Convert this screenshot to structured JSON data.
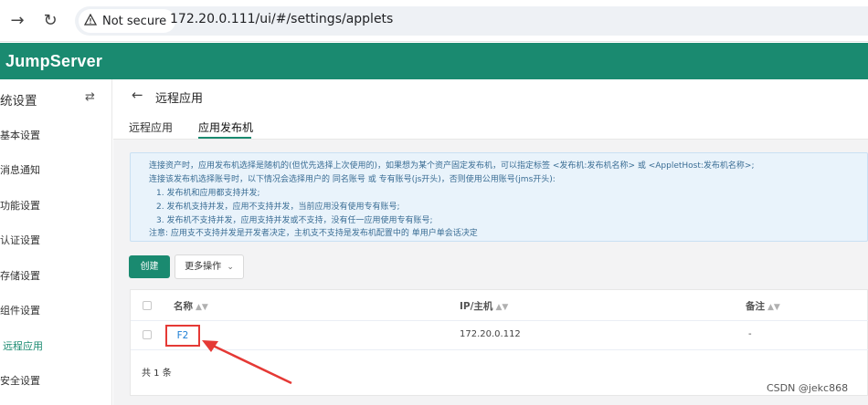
{
  "browser": {
    "back_icon": "arrow-right-icon",
    "reload_icon": "reload-icon",
    "secure_label": "Not secure",
    "url": "172.20.0.111/ui/#/settings/applets"
  },
  "header": {
    "brand": "JumpServer",
    "accent_color": "#1a8a70"
  },
  "sidebar": {
    "title": "统设置",
    "items": [
      {
        "label": "基本设置"
      },
      {
        "label": "消息通知"
      },
      {
        "label": "功能设置"
      },
      {
        "label": "认证设置"
      },
      {
        "label": "存储设置"
      },
      {
        "label": "组件设置"
      },
      {
        "label": "远程应用"
      },
      {
        "label": "安全设置"
      }
    ]
  },
  "page": {
    "title": "远程应用",
    "tabs": [
      {
        "label": "远程应用"
      },
      {
        "label": "应用发布机"
      }
    ],
    "alert": [
      "连接资产时，应用发布机选择是随机的(但优先选择上次使用的)，如果想为某个资产固定发布机，可以指定标签 <发布机:发布机名称> 或 <AppletHost:发布机名称>;",
      "连接该发布机选择账号时，以下情况会选择用户的 同名账号 或 专有账号(js开头)，否则使用公用账号(jms开头):",
      "1. 发布机和应用都支持并发;",
      "2. 发布机支持并发，应用不支持并发，当前应用没有使用专有账号;",
      "3. 发布机不支持并发，应用支持并发或不支持，没有任一应用使用专有账号;",
      "注意: 应用支不支持并发是开发者决定，主机支不支持是发布机配置中的 单用户单会话决定"
    ],
    "create_label": "创建",
    "more_label": "更多操作"
  },
  "table": {
    "columns": [
      "名称",
      "IP/主机",
      "备注"
    ],
    "rows": [
      {
        "name": "F2",
        "ip": "172.20.0.112",
        "comment": "-"
      }
    ],
    "total": "共 1 条"
  },
  "watermark": "CSDN @jekc868"
}
